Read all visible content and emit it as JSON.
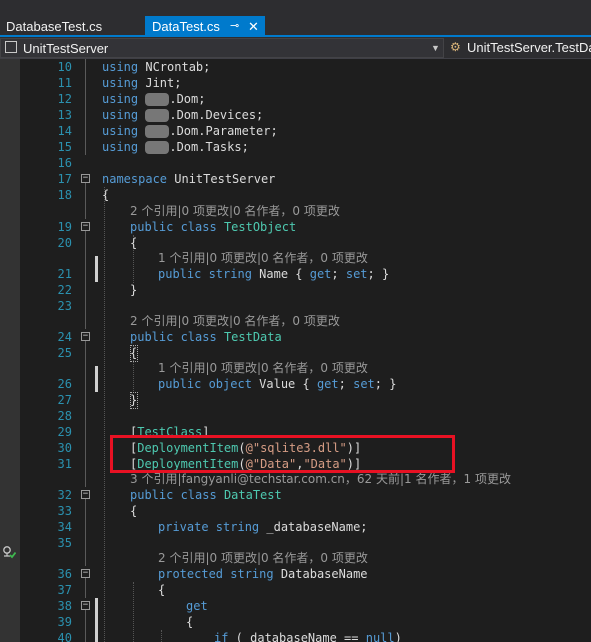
{
  "tabs": [
    {
      "label": "DatabaseTest.cs",
      "active": false
    },
    {
      "label": "DataTest.cs",
      "active": true,
      "pin_icon": "pin-icon",
      "close_icon": "close-icon"
    }
  ],
  "nav": {
    "project": "UnitTestServer",
    "class_path": "UnitTestServer.TestDa"
  },
  "colors": {
    "keyword": "#569cd6",
    "type": "#4ec9b0",
    "string": "#d69d85",
    "line_number": "#2b91af",
    "accent": "#007acc",
    "highlight_box": "#e81123"
  },
  "lines": [
    {
      "n": "10",
      "c": "using NCrontab;"
    },
    {
      "n": "11",
      "c": "using Jint;"
    },
    {
      "n": "12",
      "c": "using [redacted].Dom;"
    },
    {
      "n": "13",
      "c": "using [redacted].Dom.Devices;"
    },
    {
      "n": "14",
      "c": "using [redacted].Dom.Parameter;"
    },
    {
      "n": "15",
      "c": "using [redacted].Dom.Tasks;"
    },
    {
      "n": "16",
      "c": ""
    },
    {
      "n": "17",
      "c": "namespace UnitTestServer"
    },
    {
      "n": "18",
      "c": "{"
    },
    {
      "n": "",
      "c": "2 个引用|0 项更改|0 名作者，0 项更改"
    },
    {
      "n": "19",
      "c": "public class TestObject"
    },
    {
      "n": "20",
      "c": "{"
    },
    {
      "n": "",
      "c": "1 个引用|0 项更改|0 名作者，0 项更改"
    },
    {
      "n": "21",
      "c": "public string Name { get; set; }"
    },
    {
      "n": "22",
      "c": "}"
    },
    {
      "n": "23",
      "c": ""
    },
    {
      "n": "",
      "c": "2 个引用|0 项更改|0 名作者，0 项更改"
    },
    {
      "n": "24",
      "c": "public class TestData"
    },
    {
      "n": "25",
      "c": "{"
    },
    {
      "n": "",
      "c": "1 个引用|0 项更改|0 名作者，0 项更改"
    },
    {
      "n": "26",
      "c": "public object Value { get; set; }"
    },
    {
      "n": "27",
      "c": "}"
    },
    {
      "n": "28",
      "c": ""
    },
    {
      "n": "29",
      "c": "[TestClass]"
    },
    {
      "n": "30",
      "c": "[DeploymentItem(@\"sqlite3.dll\")]"
    },
    {
      "n": "31",
      "c": "[DeploymentItem(@\"Data\",\"Data\")]"
    },
    {
      "n": "",
      "c": "3 个引用|fangyanli@techstar.com.cn，62 天前|1 名作者，1 项更改"
    },
    {
      "n": "32",
      "c": "public class DataTest"
    },
    {
      "n": "33",
      "c": "{"
    },
    {
      "n": "34",
      "c": "private string _databaseName;"
    },
    {
      "n": "35",
      "c": ""
    },
    {
      "n": "",
      "c": "2 个引用|0 项更改|0 名作者，0 项更改"
    },
    {
      "n": "36",
      "c": "protected string DatabaseName"
    },
    {
      "n": "37",
      "c": "{"
    },
    {
      "n": "38",
      "c": "get"
    },
    {
      "n": "39",
      "c": "{"
    },
    {
      "n": "40",
      "c": "if ( databaseName == null)"
    }
  ]
}
